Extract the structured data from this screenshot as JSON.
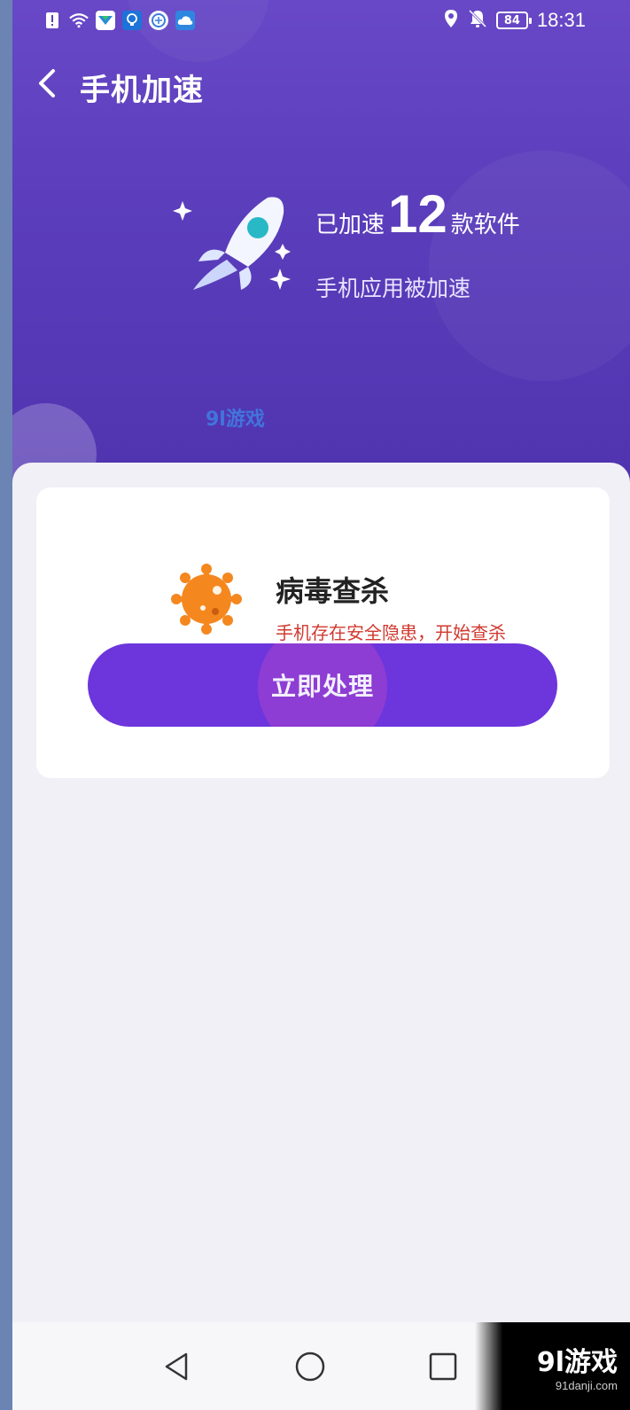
{
  "status_bar": {
    "battery": "84",
    "time": "18:31",
    "icons": [
      "alert-icon",
      "wifi-icon",
      "app-icon",
      "bulb-icon",
      "browser-icon",
      "cloud-icon",
      "location-icon",
      "bell-off-icon"
    ]
  },
  "header": {
    "title": "手机加速",
    "back_icon": "chevron-left-icon"
  },
  "hero": {
    "prefix": "已加速",
    "count": "12",
    "suffix": "款软件",
    "subtitle": "手机应用被加速",
    "watermark": "9l游戏"
  },
  "card": {
    "title": "病毒查杀",
    "subtitle": "手机存在安全隐患，开始查杀",
    "button_label": "立即处理"
  },
  "nav": {
    "back": "triangle-back-icon",
    "home": "circle-home-icon",
    "recent": "square-recent-icon"
  },
  "corner_logo": {
    "main": "9l游戏",
    "sub": "91danji.com"
  },
  "colors": {
    "hero_top": "#6848c6",
    "hero_bottom": "#4f33ae",
    "button": "#6d35dc",
    "alert_text": "#d0392f",
    "virus_orange": "#f5871f"
  }
}
